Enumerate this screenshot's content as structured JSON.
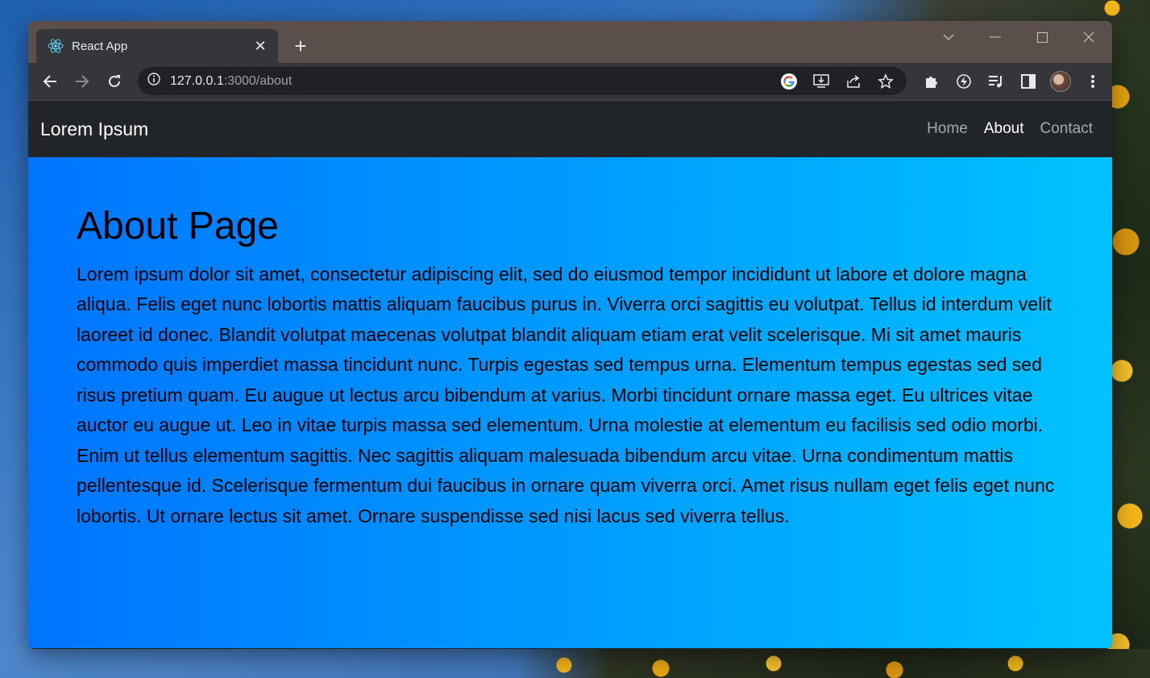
{
  "browser": {
    "tab_title": "React App",
    "new_tab_symbol": "+",
    "close_symbol": "✕",
    "url_host": "127.0.0.1",
    "url_path": ":3000/about"
  },
  "navbar": {
    "brand": "Lorem Ipsum",
    "links": [
      {
        "label": "Home",
        "active": false
      },
      {
        "label": "About",
        "active": true
      },
      {
        "label": "Contact",
        "active": false
      }
    ]
  },
  "page": {
    "heading": "About Page",
    "body": "Lorem ipsum dolor sit amet, consectetur adipiscing elit, sed do eiusmod tempor incididunt ut labore et dolore magna aliqua. Felis eget nunc lobortis mattis aliquam faucibus purus in. Viverra orci sagittis eu volutpat. Tellus id interdum velit laoreet id donec. Blandit volutpat maecenas volutpat blandit aliquam etiam erat velit scelerisque. Mi sit amet mauris commodo quis imperdiet massa tincidunt nunc. Turpis egestas sed tempus urna. Elementum tempus egestas sed sed risus pretium quam. Eu augue ut lectus arcu bibendum at varius. Morbi tincidunt ornare massa eget. Eu ultrices vitae auctor eu augue ut. Leo in vitae turpis massa sed elementum. Urna molestie at elementum eu facilisis sed odio morbi. Enim ut tellus elementum sagittis. Nec sagittis aliquam malesuada bibendum arcu vitae. Urna condimentum mattis pellentesque id. Scelerisque fermentum dui faucibus in ornare quam viverra orci. Amet risus nullam eget felis eget nunc lobortis. Ut ornare lectus sit amet. Ornare suspendisse sed nisi lacus sed viverra tellus."
  },
  "colors": {
    "navbar_bg": "#212529",
    "gradient_start": "#0074ff",
    "gradient_end": "#00c2ff",
    "tab_bg": "#35363a",
    "titlebar_bg": "#5a4f4b"
  },
  "icons": {
    "tab_favicon": "react-logo-icon",
    "back": "arrow-left-icon",
    "forward": "arrow-right-icon",
    "reload": "reload-icon",
    "site_info": "info-icon",
    "google_lens": "google-icon",
    "install": "install-icon",
    "share": "share-icon",
    "bookmark": "star-icon",
    "extensions": "puzzle-icon",
    "extension_bolt": "bolt-icon",
    "media": "media-queue-icon",
    "side_panel": "side-panel-icon",
    "menu": "kebab-menu-icon"
  }
}
